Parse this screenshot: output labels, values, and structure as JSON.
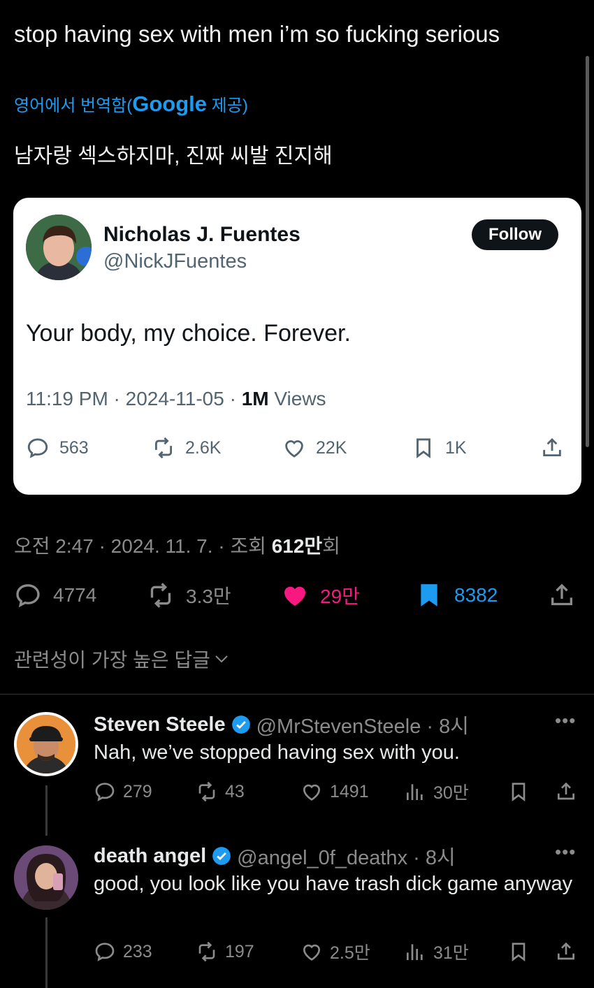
{
  "tweet": {
    "text": "stop having sex with men i’m so fucking serious",
    "translate_prefix": "영어에서 번역함(",
    "translate_provider": "Google",
    "translate_suffix": " 제공)",
    "translated_text": "남자랑 섹스하지마, 진짜 씨발 진지해",
    "time": "오전 2:47 · 2024. 11. 7. · 조회 ",
    "views_number": "612",
    "views_unit": "만",
    "views_suffix": "회",
    "stats": {
      "replies": "4774",
      "reposts": "3.3만",
      "likes": "29만",
      "bookmarks": "8382"
    },
    "colors": {
      "like": "#f91880",
      "bookmark": "#1d9bf0",
      "link": "#1d9bf0"
    }
  },
  "quoted": {
    "name": "Nicholas J. Fuentes",
    "handle": "@NickJFuentes",
    "follow_label": "Follow",
    "text": "Your body, my choice. Forever.",
    "meta_time": "11:19 PM · 2024-11-05 · ",
    "meta_views": "1M",
    "meta_views_label": " Views",
    "stats": {
      "replies": "563",
      "reposts": "2.6K",
      "likes": "22K",
      "bookmarks": "1K"
    }
  },
  "sort_label": "관련성이 가장 높은 답글",
  "replies": [
    {
      "name": "Steven Steele",
      "handle": "@MrStevenSteele · 8시",
      "text": "Nah, we’ve stopped having sex with you.",
      "stats": {
        "replies": "279",
        "reposts": "43",
        "likes": "1491",
        "views": "30만"
      },
      "verified": true
    },
    {
      "name": "death angel",
      "handle": "@angel_0f_deathx · 8시",
      "text": "good, you look like you have trash dick game anyway",
      "stats": {
        "replies": "233",
        "reposts": "197",
        "likes": "2.5만",
        "views": "31만"
      },
      "verified": true
    }
  ],
  "icons": [
    "reply-icon",
    "repost-icon",
    "like-icon",
    "bookmark-icon",
    "share-icon",
    "views-icon",
    "verified-icon",
    "more-icon",
    "chevron-down-icon"
  ]
}
